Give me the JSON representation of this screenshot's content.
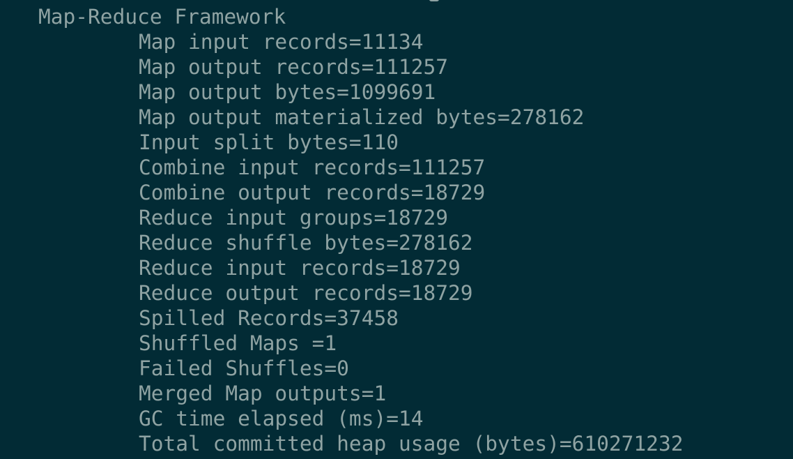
{
  "terminal": {
    "group_header": "Map-Reduce Framework",
    "counters": [
      "Map input records=11134",
      "Map output records=111257",
      "Map output bytes=1099691",
      "Map output materialized bytes=278162",
      "Input split bytes=110",
      "Combine input records=111257",
      "Combine output records=18729",
      "Reduce input groups=18729",
      "Reduce shuffle bytes=278162",
      "Reduce input records=18729",
      "Reduce output records=18729",
      "Spilled Records=37458",
      "Shuffled Maps =1",
      "Failed Shuffles=0",
      "Merged Map outputs=1",
      "GC time elapsed (ms)=14",
      "Total committed heap usage (bytes)=610271232"
    ]
  }
}
